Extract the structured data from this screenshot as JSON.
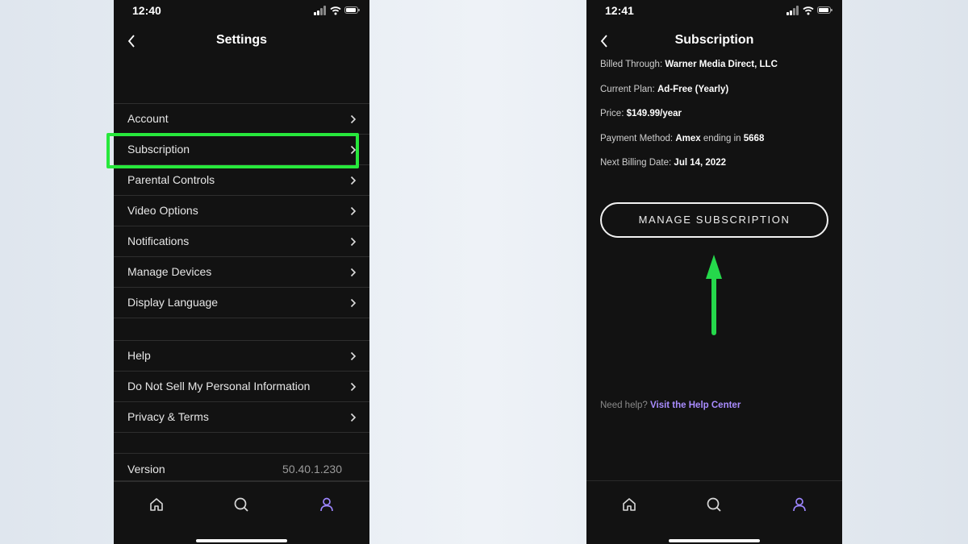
{
  "left_screen": {
    "status": {
      "time": "12:40"
    },
    "header": {
      "title": "Settings"
    },
    "groups": [
      {
        "items": [
          "Account",
          "Subscription",
          "Parental Controls",
          "Video Options",
          "Notifications",
          "Manage Devices",
          "Display Language"
        ]
      },
      {
        "items": [
          "Help",
          "Do Not Sell My Personal Information",
          "Privacy & Terms"
        ]
      }
    ],
    "highlighted_item": "Subscription",
    "version": {
      "label": "Version",
      "value": "50.40.1.230"
    },
    "tabs": [
      {
        "icon": "home-icon"
      },
      {
        "icon": "search-icon"
      },
      {
        "icon": "profile-icon",
        "active": true
      }
    ]
  },
  "right_screen": {
    "status": {
      "time": "12:41"
    },
    "header": {
      "title": "Subscription"
    },
    "details": {
      "billed_through_label": "Billed Through:",
      "billed_through_value": "Warner Media Direct, LLC",
      "plan_label": "Current Plan:",
      "plan_value": "Ad-Free (Yearly)",
      "price_label": "Price:",
      "price_value": "$149.99/year",
      "payment_label": "Payment Method:",
      "payment_card": "Amex",
      "payment_mid": "ending in",
      "payment_last4": "5668",
      "next_billing_label": "Next Billing Date:",
      "next_billing_value": "Jul 14, 2022"
    },
    "manage_button": "MANAGE SUBSCRIPTION",
    "help": {
      "prompt": "Need help?",
      "link": "Visit the Help Center"
    },
    "tabs": [
      {
        "icon": "home-icon"
      },
      {
        "icon": "search-icon"
      },
      {
        "icon": "profile-icon",
        "active": true
      }
    ]
  },
  "colors": {
    "background": "#121212",
    "highlight": "#27e83c",
    "arrow": "#25d84b",
    "accent": "#a98cff"
  }
}
